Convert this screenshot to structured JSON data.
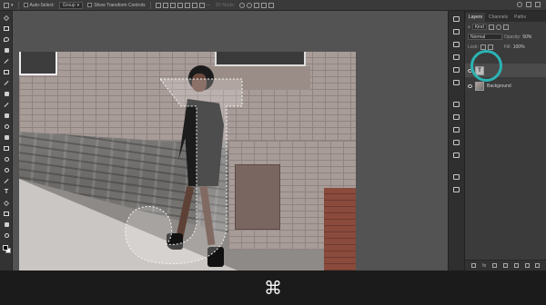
{
  "options_bar": {
    "auto_select_label": "Auto-Select:",
    "auto_select_value": "Group",
    "transform_label": "Show Transform Controls",
    "mode_3d_label": "3D Mode:"
  },
  "toolbar": {
    "tools": [
      "move-tool",
      "marquee-tool",
      "lasso-tool",
      "quick-select-tool",
      "crop-tool",
      "frame-tool",
      "eyedropper-tool",
      "healing-tool",
      "brush-tool",
      "stamp-tool",
      "history-brush-tool",
      "eraser-tool",
      "gradient-tool",
      "blur-tool",
      "dodge-tool",
      "pen-tool",
      "type-tool",
      "path-select-tool",
      "shape-tool",
      "hand-tool",
      "zoom-tool"
    ],
    "type_tool_glyph": "T"
  },
  "layers_panel": {
    "tabs": [
      {
        "label": "Layers",
        "active": true
      },
      {
        "label": "Channels",
        "active": false
      },
      {
        "label": "Paths",
        "active": false
      }
    ],
    "filter_kind": "Kind",
    "blend_mode": "Normal",
    "opacity_label": "Opacity:",
    "opacity_value": "50%",
    "lock_label": "Lock:",
    "fill_label": "Fill:",
    "fill_value": "100%",
    "layers": [
      {
        "name": "",
        "type": "type",
        "thumb_glyph": "T",
        "selected": true
      },
      {
        "name": "Background",
        "type": "image",
        "selected": false
      }
    ],
    "bottom_fx": "fx",
    "highlight_color": "#2bb3b3"
  },
  "shortcut_bar": {
    "symbol": "⌘"
  }
}
